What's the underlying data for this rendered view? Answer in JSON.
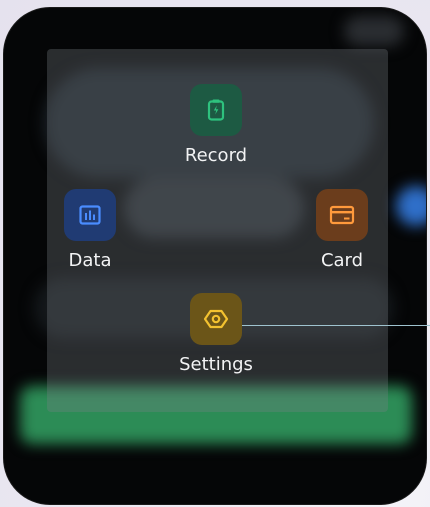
{
  "menu": {
    "record": {
      "label": "Record",
      "icon": "clipboard-charge-icon",
      "color": "#2ec27e"
    },
    "data": {
      "label": "Data",
      "icon": "bar-chart-icon",
      "color": "#4a8cff"
    },
    "card": {
      "label": "Card",
      "icon": "card-icon",
      "color": "#ff9a3c"
    },
    "settings": {
      "label": "Settings",
      "icon": "hexagon-settings-icon",
      "color": "#f3c230"
    }
  }
}
